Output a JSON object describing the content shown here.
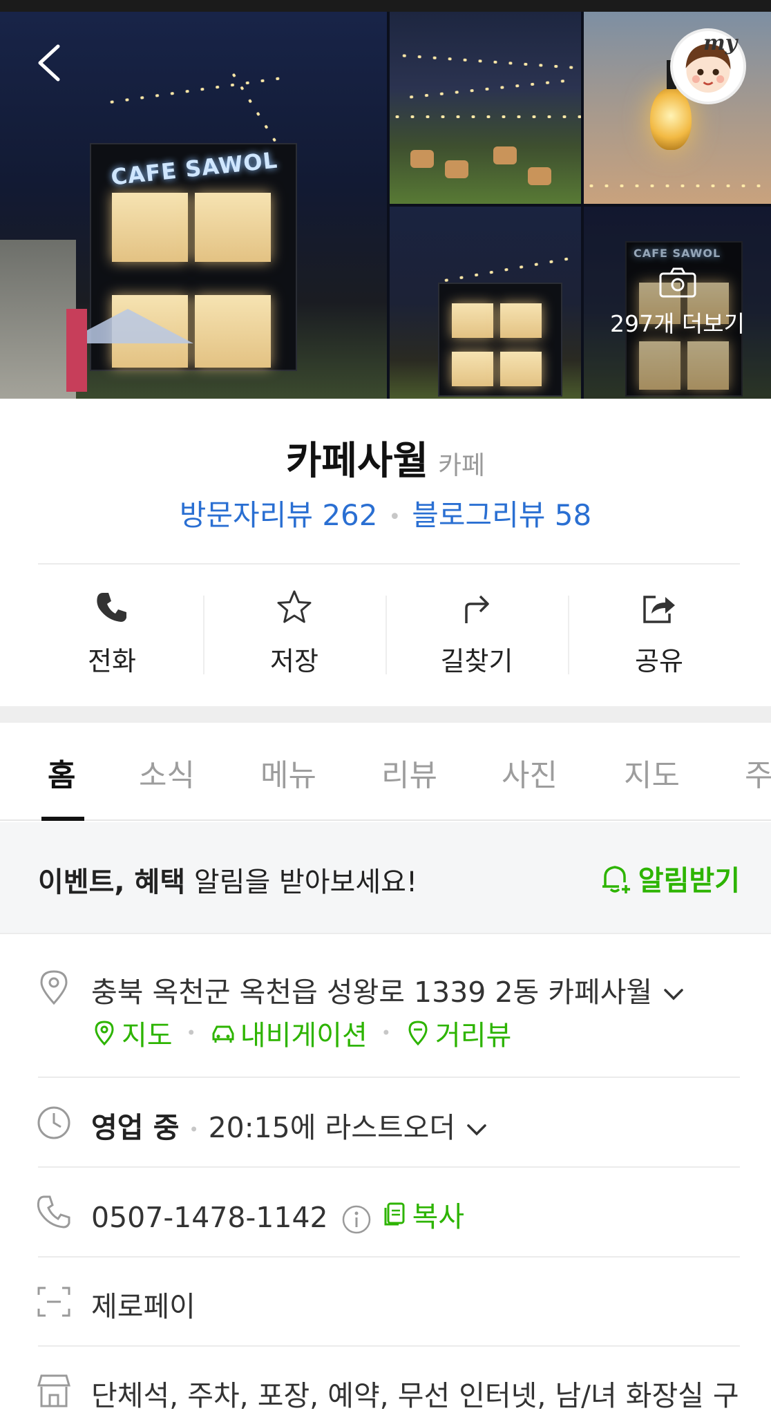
{
  "gallery": {
    "main_sign": "CAFE SAWOL",
    "thumb_sign": "CAFE SAWOL",
    "more_photos_label": "297개 더보기",
    "avatar_badge": "my"
  },
  "place": {
    "name": "카페사월",
    "category": "카페",
    "visitor_reviews": "방문자리뷰 262",
    "blog_reviews": "블로그리뷰 58"
  },
  "actions": [
    {
      "label": "전화",
      "icon": "phone-icon"
    },
    {
      "label": "저장",
      "icon": "star-icon"
    },
    {
      "label": "길찾기",
      "icon": "directions-icon"
    },
    {
      "label": "공유",
      "icon": "share-icon"
    }
  ],
  "tabs": [
    {
      "label": "홈",
      "active": true
    },
    {
      "label": "소식"
    },
    {
      "label": "메뉴"
    },
    {
      "label": "리뷰"
    },
    {
      "label": "사진"
    },
    {
      "label": "지도"
    },
    {
      "label": "주"
    }
  ],
  "notice": {
    "bold": "이벤트, 혜택",
    "text": " 알림을 받아보세요!",
    "subscribe_label": "알림받기",
    "accent_color": "#2db400"
  },
  "info": {
    "address": "충북 옥천군 옥천읍 성왕로 1339 2동 카페사월",
    "map_link": "지도",
    "navi_link": "내비게이션",
    "street_link": "거리뷰",
    "status": "영업 중",
    "last_order": "20:15에 라스트오더",
    "phone": "0507-1478-1142",
    "copy_label": "복사",
    "pay": "제로페이",
    "amenities": "단체석, 주차, 포장, 예약, 무선 인터넷, 남/녀 화장실 구"
  },
  "colors": {
    "link_blue": "#2a6fd2",
    "green": "#2db400"
  }
}
